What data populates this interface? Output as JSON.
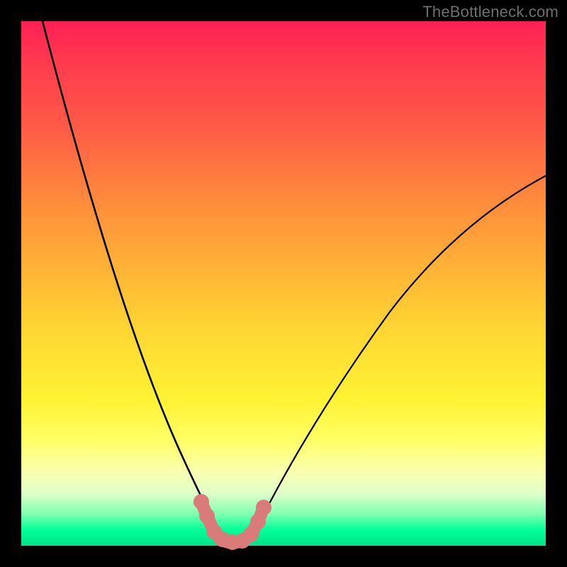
{
  "watermark": "TheBottleneck.com",
  "colors": {
    "frame": "#000000",
    "curve": "#000000",
    "highlight": "#d97b78"
  },
  "chart_data": {
    "type": "line",
    "title": "",
    "xlabel": "",
    "ylabel": "",
    "xlim": [
      0,
      100
    ],
    "ylim": [
      0,
      100
    ],
    "grid": false,
    "series": [
      {
        "name": "left_curve",
        "x": [
          4,
          8,
          12,
          16,
          20,
          24,
          28,
          32,
          34,
          36,
          38
        ],
        "y": [
          100,
          78,
          58,
          42,
          28,
          17,
          9,
          3,
          1.5,
          0.5,
          0
        ]
      },
      {
        "name": "right_curve",
        "x": [
          42,
          44,
          46,
          50,
          56,
          64,
          74,
          86,
          100
        ],
        "y": [
          0,
          0.5,
          2,
          6,
          13,
          24,
          38,
          54,
          70
        ]
      },
      {
        "name": "valley_highlight",
        "x": [
          34,
          35,
          36,
          38,
          40,
          42,
          44,
          45,
          46
        ],
        "y": [
          3,
          1.5,
          0.8,
          0,
          0,
          0,
          0.8,
          1.5,
          3
        ]
      }
    ],
    "annotations": []
  }
}
